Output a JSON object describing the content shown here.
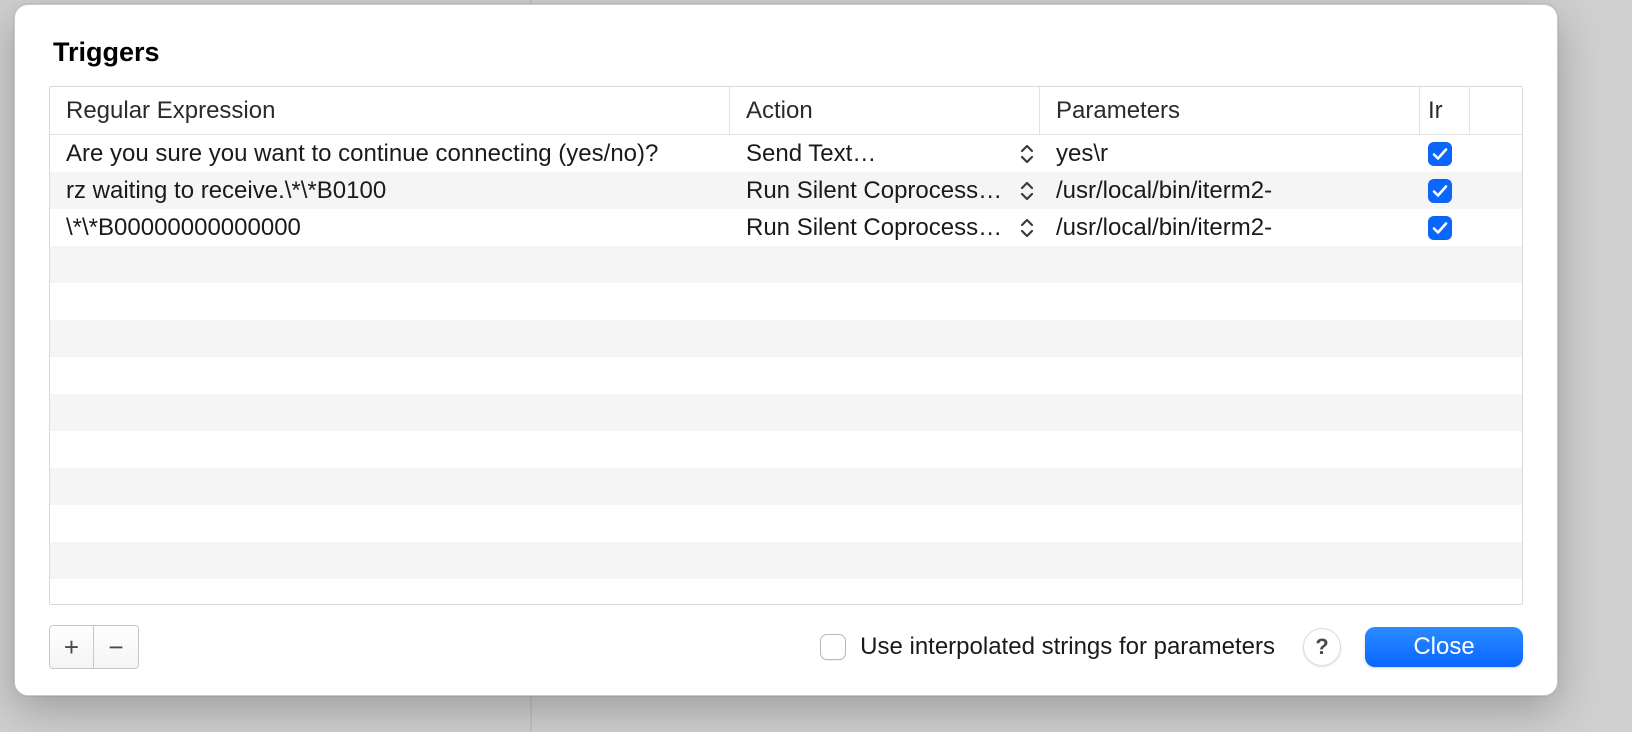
{
  "dialog": {
    "title": "Triggers",
    "columns": {
      "regex": "Regular Expression",
      "action": "Action",
      "params": "Parameters",
      "ir": "Ir"
    },
    "rows": [
      {
        "regex": "Are you sure you want to continue connecting (yes/no)?",
        "action": "Send Text…",
        "params": "yes\\r",
        "checked": true
      },
      {
        "regex": "rz waiting to receive.\\*\\*B0100",
        "action": "Run Silent Coprocess…",
        "params": "/usr/local/bin/iterm2-",
        "checked": true
      },
      {
        "regex": "\\*\\*B00000000000000",
        "action": "Run Silent Coprocess…",
        "params": "/usr/local/bin/iterm2-",
        "checked": true
      }
    ],
    "blank_row_count": 9
  },
  "footer": {
    "add_label": "+",
    "remove_label": "−",
    "interpolated_label": "Use interpolated strings for parameters",
    "interpolated_checked": false,
    "help_label": "?",
    "close_label": "Close"
  }
}
